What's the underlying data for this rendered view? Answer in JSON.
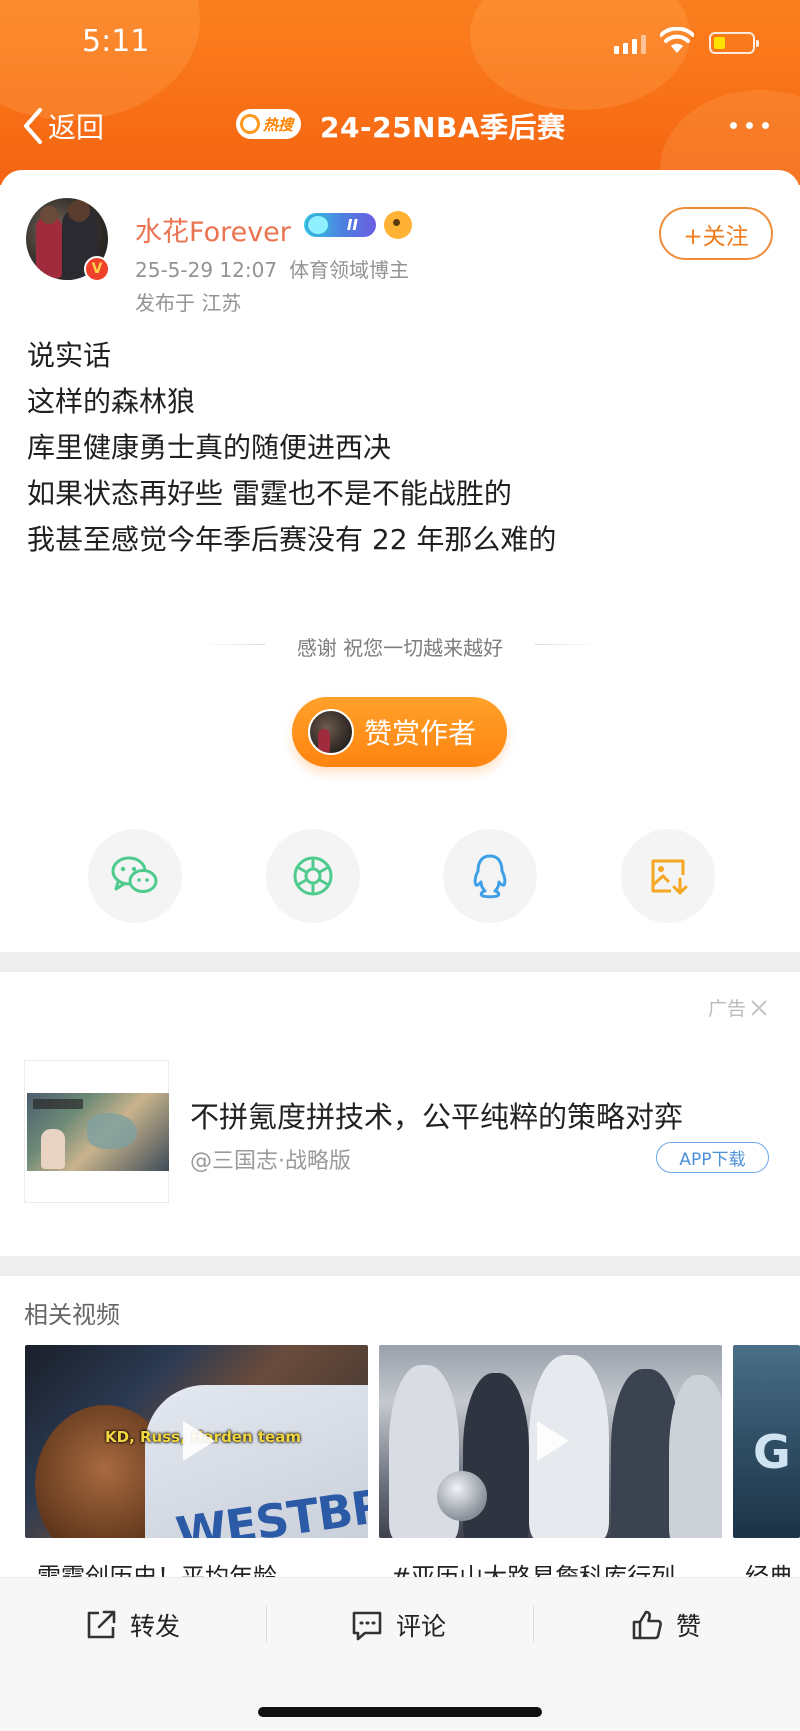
{
  "status_bar": {
    "time": "5:11"
  },
  "nav": {
    "back_label": "返回",
    "hot_badge": "热搜",
    "title": "24-25NBA季后赛"
  },
  "post": {
    "author": {
      "name": "水花Forever",
      "level_badge": "II",
      "verified_badge": "V",
      "follow_label": "+关注"
    },
    "meta": {
      "timestamp": "25-5-29 12:07",
      "tag": "体育领域博主",
      "location": "发布于 江苏"
    },
    "lines": [
      "说实话",
      "这样的森林狼",
      "库里健康勇士真的随便进西决",
      "如果状态再好些 雷霆也不是不能战胜的",
      "我甚至感觉今年季后赛没有 22 年那么难的"
    ],
    "thanks_text": "感谢 祝您一切越来越好",
    "reward_label": "赞赏作者"
  },
  "share": {
    "items": [
      {
        "name": "wechat",
        "icon": "wechat-icon",
        "color": "#4ecb8d"
      },
      {
        "name": "moments",
        "icon": "moments-icon",
        "color": "#4ecb8d"
      },
      {
        "name": "qq",
        "icon": "qq-icon",
        "color": "#3fa0e8"
      },
      {
        "name": "save-image",
        "icon": "save-image-icon",
        "color": "#f5a623"
      }
    ]
  },
  "ad": {
    "label": "广告",
    "title": "不拼氪度拼技术，公平纯粹的策略对弈",
    "source": "@三国志·战略版",
    "download_label": "APP下载"
  },
  "related": {
    "title": "相关视频",
    "videos": [
      {
        "caption": "雷霆创历史！平均年龄",
        "overlay_text": "KD, Russ, Harden team"
      },
      {
        "caption": "#亚历山大路易詹科库行列"
      },
      {
        "caption": "经典"
      }
    ]
  },
  "bottom_bar": {
    "repost": "转发",
    "comment": "评论",
    "like": "赞"
  },
  "colors": {
    "header_orange": "#fb7f1e",
    "author_name": "#eb7350",
    "follow_border": "#f08c38",
    "reward_button": "#ff8c1a",
    "ad_link_blue": "#4b8fd8"
  }
}
